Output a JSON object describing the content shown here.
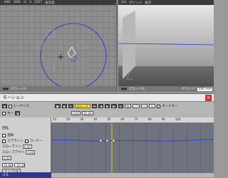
{
  "viewport_left": {
    "header": [
      "-440",
      "-600",
      "-4",
      "3",
      "1357",
      "表示枠"
    ],
    "footer_label": "グローバル"
  },
  "viewport_right": {
    "header": [
      "1m",
      "グリッド",
      "表示"
    ],
    "footer_label": "グローバル",
    "footer_badge": "グリッド:",
    "footer_value": "100 mm"
  },
  "motion": {
    "title": "モーション",
    "close": "×",
    "seq_label": "シーケンス",
    "key_label": "キー",
    "step_label": "ステップ",
    "auto_label": "オートキー",
    "frame_value": "0.00",
    "frame_total": "35.00",
    "ruler": [
      "10",
      "20",
      "30",
      "40",
      "50",
      "60",
      "70",
      "80",
      "90",
      "100"
    ],
    "rows": {
      "rotate": "回転",
      "slope_in": "スロープイン",
      "slope_out": "スロープアウト",
      "linear": "直線",
      "spline": "スプライン",
      "corner": "コーナー",
      "v1": "0.00",
      "v2": "0.00",
      "v3": "0.00",
      "out1": "20.80",
      "out2": "-10.30",
      "gen": "グラフ生成"
    },
    "footer": "パス"
  }
}
